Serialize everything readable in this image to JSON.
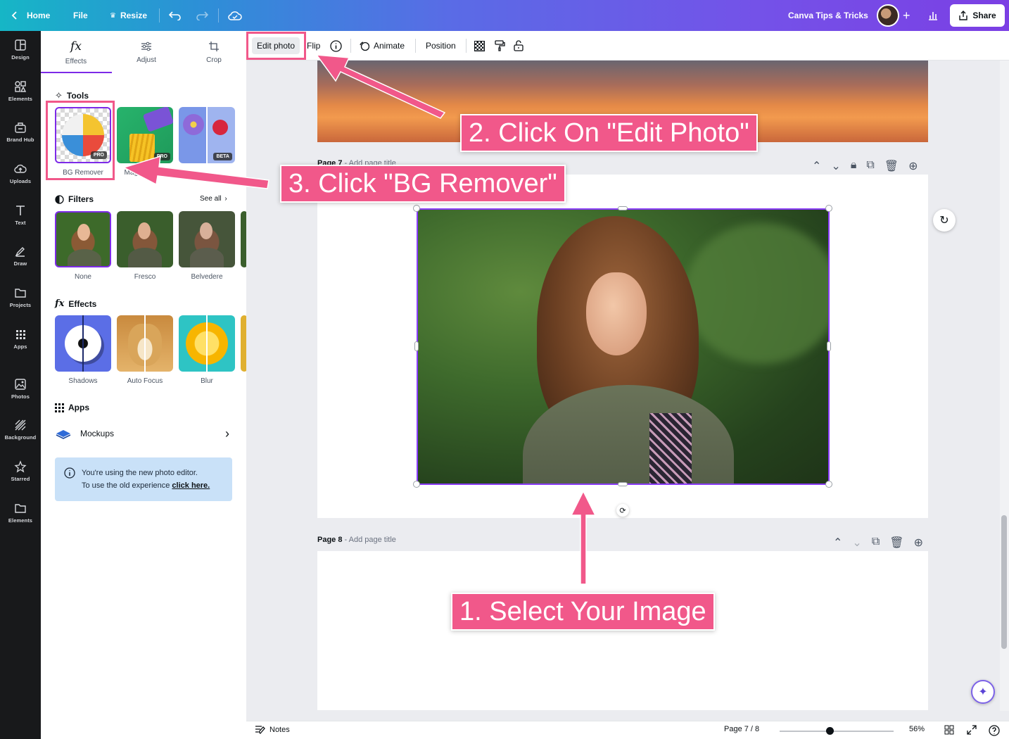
{
  "topbar": {
    "home": "Home",
    "file": "File",
    "resize": "Resize",
    "title": "Canva Tips & Tricks",
    "share": "Share"
  },
  "rail": [
    {
      "label": "Design",
      "icon": "design-icon"
    },
    {
      "label": "Elements",
      "icon": "elements-icon"
    },
    {
      "label": "Brand Hub",
      "icon": "brand-hub-icon"
    },
    {
      "label": "Uploads",
      "icon": "uploads-icon"
    },
    {
      "label": "Text",
      "icon": "text-icon"
    },
    {
      "label": "Draw",
      "icon": "draw-icon"
    },
    {
      "label": "Projects",
      "icon": "projects-icon"
    },
    {
      "label": "Apps",
      "icon": "apps-icon"
    },
    {
      "label": "Photos",
      "icon": "photos-icon"
    },
    {
      "label": "Background",
      "icon": "background-icon"
    },
    {
      "label": "Starred",
      "icon": "star-icon"
    },
    {
      "label": "Elements",
      "icon": "folder-icon"
    }
  ],
  "panel": {
    "tabs": [
      {
        "label": "Effects",
        "icon": "fx-icon"
      },
      {
        "label": "Adjust",
        "icon": "sliders-icon"
      },
      {
        "label": "Crop",
        "icon": "crop-icon"
      }
    ],
    "tools_title": "Tools",
    "tools": [
      {
        "label": "BG Remover",
        "badge": "PRO"
      },
      {
        "label": "Magic Eraser",
        "badge": "PRO"
      },
      {
        "label": "",
        "badge": "BETA"
      }
    ],
    "filters_title": "Filters",
    "see_all": "See all",
    "filters": [
      {
        "label": "None"
      },
      {
        "label": "Fresco"
      },
      {
        "label": "Belvedere"
      }
    ],
    "effects_title": "Effects",
    "effects": [
      {
        "label": "Shadows"
      },
      {
        "label": "Auto Focus"
      },
      {
        "label": "Blur"
      }
    ],
    "apps_title": "Apps",
    "mockups": "Mockups",
    "info_line1": "You're using the new photo editor.",
    "info_line2": "To use the old experience ",
    "info_link": "click here."
  },
  "ctxbar": {
    "edit_photo": "Edit photo",
    "flip": "Flip",
    "animate": "Animate",
    "position": "Position"
  },
  "canvas": {
    "page7_label": "Page 7",
    "page7_sub": " - Add page title",
    "page8_label": "Page 8",
    "page8_sub": " - Add page title"
  },
  "bottombar": {
    "notes": "Notes",
    "page_indicator": "Page 7 / 8",
    "zoom": "56%",
    "zoom_fraction": 0.56
  },
  "annotations": {
    "step1": "1. Select Your Image",
    "step2": "2. Click On \"Edit Photo\"",
    "step3": "3. Click \"BG Remover\""
  },
  "colors": {
    "accent": "#7d2ae8",
    "annotation": "#f1588a",
    "info_bg": "#c9e1f8"
  }
}
